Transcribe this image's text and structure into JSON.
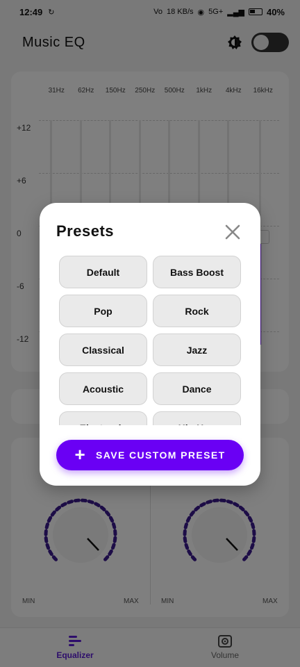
{
  "status_bar": {
    "time": "12:49",
    "network_speed": "18 KB/s",
    "network_type": "5G+",
    "battery": "40%"
  },
  "header": {
    "title": "Music EQ",
    "theme_icon": "brightness-icon",
    "toggle_state": "off"
  },
  "equalizer": {
    "bands": [
      "31Hz",
      "62Hz",
      "150Hz",
      "250Hz",
      "500Hz",
      "1kHz",
      "4kHz",
      "16kHz"
    ],
    "db_scale": [
      "+12",
      "+6",
      "0",
      "-6",
      "-12"
    ]
  },
  "knobs": {
    "min_label": "MIN",
    "max_label": "MAX"
  },
  "bottom_nav": {
    "items": [
      {
        "label": "Equalizer",
        "icon": "equalizer-icon",
        "active": true
      },
      {
        "label": "Volume",
        "icon": "speaker-icon",
        "active": false
      }
    ]
  },
  "dialog": {
    "title": "Presets",
    "presets": [
      "Default",
      "Bass Boost",
      "Pop",
      "Rock",
      "Classical",
      "Jazz",
      "Acoustic",
      "Dance",
      "Electronic",
      "Hip Hop"
    ],
    "save_label": "SAVE CUSTOM PRESET"
  },
  "colors": {
    "accent": "#6a00f4",
    "nav_active": "#5b1bd6",
    "knob_dots": "#3b1a8f"
  }
}
